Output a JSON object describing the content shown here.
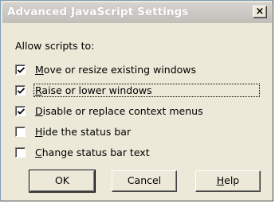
{
  "window": {
    "title": "Advanced JavaScript Settings",
    "close_glyph": "×"
  },
  "prompt": "Allow scripts to:",
  "options": [
    {
      "pre": "",
      "u": "M",
      "post": "ove or resize existing windows",
      "checked": true
    },
    {
      "pre": "",
      "u": "R",
      "post": "aise or lower windows",
      "checked": true
    },
    {
      "pre": "",
      "u": "D",
      "post": "isable or replace context menus",
      "checked": true
    },
    {
      "pre": "",
      "u": "H",
      "post": "ide the status bar",
      "checked": false
    },
    {
      "pre": "",
      "u": "C",
      "post": "hange status bar text",
      "checked": false
    }
  ],
  "buttons": {
    "ok": "OK",
    "cancel": "Cancel",
    "help_u": "H",
    "help_rest": "elp"
  }
}
